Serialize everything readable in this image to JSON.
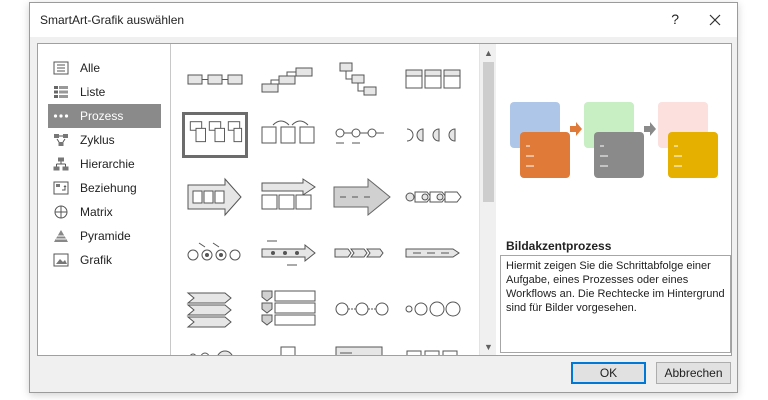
{
  "window": {
    "title": "SmartArt-Grafik auswählen",
    "help": "?",
    "close_icon": "close-icon"
  },
  "categories": [
    {
      "label": "Alle",
      "icon": "all-icon",
      "selected": false
    },
    {
      "label": "Liste",
      "icon": "list-icon",
      "selected": false
    },
    {
      "label": "Prozess",
      "icon": "process-icon",
      "selected": true
    },
    {
      "label": "Zyklus",
      "icon": "cycle-icon",
      "selected": false
    },
    {
      "label": "Hierarchie",
      "icon": "hierarchy-icon",
      "selected": false
    },
    {
      "label": "Beziehung",
      "icon": "relationship-icon",
      "selected": false
    },
    {
      "label": "Matrix",
      "icon": "matrix-icon",
      "selected": false
    },
    {
      "label": "Pyramide",
      "icon": "pyramid-icon",
      "selected": false
    },
    {
      "label": "Grafik",
      "icon": "picture-icon",
      "selected": false
    }
  ],
  "gallery": {
    "rows": 6,
    "columns": 4,
    "selected_index": 4
  },
  "preview": {
    "name": "Bildakzentprozess",
    "description": "Hiermit zeigen Sie die Schrittabfolge einer Aufgabe, eines Prozesses oder eines Workflows an. Die Rechtecke im Hintergrund sind für Bilder vorgesehen.",
    "colors": [
      "#aec7e8",
      "#e07a38",
      "#c8eec3",
      "#8a8a8a",
      "#fbe0dd",
      "#e6b000"
    ]
  },
  "buttons": {
    "ok": "OK",
    "cancel": "Abbrechen"
  },
  "colors": {
    "accent": "#0078d7",
    "selection": "#8a8a8a"
  }
}
